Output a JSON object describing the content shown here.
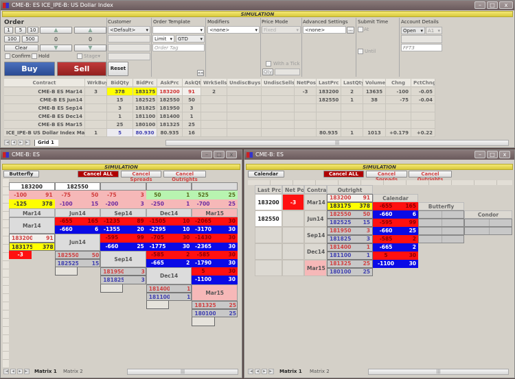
{
  "top_window": {
    "title": "CME-B: ES ICE_IPE-B: US Dollar Index",
    "sim_label": "SIMULATION"
  },
  "order": {
    "heading": "Order",
    "qty_buttons": [
      "1",
      "5",
      "10",
      "100",
      "500"
    ],
    "clear": "Clear",
    "spinner1_value": "0",
    "spinner2_value": "0",
    "confirm": "Confirm",
    "hold": "Hold",
    "stage": "Stage",
    "buy": "Buy",
    "sell": "Sell",
    "reset": "Reset",
    "customer_label": "Customer",
    "customer_value": "<Default>",
    "template_label": "Order Template",
    "template_value": "",
    "order_type": "Limit",
    "tif": "GTD",
    "order_tag_placeholder": "Order Tag",
    "collapse": "<<",
    "modifiers_label": "Modifiers",
    "modifiers_value": "<none>",
    "price_mode_label": "Price Mode",
    "price_mode_value": "Fixed",
    "with_tick": "With a Tick",
    "qty_label": "Qty",
    "advanced_label": "Advanced Settings",
    "advanced_value": "<none>",
    "advanced_btn": "...",
    "submit_label": "Submit Time",
    "at": "At",
    "until": "Until",
    "account_label": "Account Details",
    "account_state": "Open",
    "account_id": "A1",
    "account_name": "FFT3"
  },
  "grid": {
    "columns": [
      "Contract",
      "WrkBuys",
      "BidQty",
      "BidPrc",
      "AskPrc",
      "AskQty",
      "WrkSells",
      "UndiscBuys",
      "UndiscSells",
      "NetPos",
      "LastPrc",
      "LastQty",
      "Volume",
      "Chng",
      "PctChng"
    ],
    "rows": [
      [
        "CME-B ES Mar14",
        "3",
        "378",
        "183175",
        "183200",
        "91",
        "2",
        "",
        "",
        "-3",
        "183200",
        "2",
        "13635",
        "-100",
        "-0.05"
      ],
      [
        "CME-B ES Jun14",
        "",
        "15",
        "182525",
        "182550",
        "50",
        "",
        "",
        "",
        "",
        "182550",
        "1",
        "38",
        "-75",
        "-0.04"
      ],
      [
        "CME-B ES Sep14",
        "",
        "3",
        "181825",
        "181950",
        "3",
        "",
        "",
        "",
        "",
        "",
        "",
        "",
        "",
        ""
      ],
      [
        "CME-B ES Dec14",
        "",
        "1",
        "181100",
        "181400",
        "1",
        "",
        "",
        "",
        "",
        "",
        "",
        "",
        "",
        ""
      ],
      [
        "CME-B ES Mar15",
        "",
        "25",
        "180100",
        "181325",
        "25",
        "",
        "",
        "",
        "",
        "",
        "",
        "",
        "",
        ""
      ],
      [
        "ICE_IPE-B US Dollar Index Mar14",
        "1",
        "5",
        "80.930",
        "80.935",
        "16",
        "",
        "",
        "",
        "",
        "80.935",
        "1",
        "1013",
        "+0.179",
        "+0.22"
      ]
    ],
    "tabs": [
      "Grid 1"
    ]
  },
  "left_window": {
    "title": "CME-B: ES",
    "sim_label": "SIMULATION",
    "mode_button": "Butterfly",
    "cancel_all": "Cancel ALL",
    "cancel_spreads": "Cancel Spreads",
    "cancel_outrights": "Cancel Outrights",
    "row_marker": "L",
    "header_prices": [
      "183200",
      "182550",
      "",
      "",
      ""
    ],
    "top_rows": [
      [
        [
          "-100",
          "91"
        ],
        [
          "-75",
          "50"
        ],
        [
          "-75",
          "3"
        ],
        [
          "50",
          "1"
        ],
        [
          "525",
          "25"
        ]
      ],
      [
        [
          "-125",
          "378"
        ],
        [
          "-100",
          "15"
        ],
        [
          "-200",
          "3"
        ],
        [
          "-250",
          "1"
        ],
        [
          "-700",
          "25"
        ]
      ]
    ],
    "contracts": [
      "Mar14",
      "Jun14",
      "Sep14",
      "Dec14",
      "Mar15"
    ],
    "spreads": [
      [
        null,
        {
          "ask": [
            "-655",
            "165"
          ],
          "bid": [
            "-660",
            "6"
          ]
        },
        {
          "ask": [
            "-1235",
            "89"
          ],
          "bid": [
            "-1355",
            "20"
          ]
        },
        {
          "ask": [
            "-1505",
            "10"
          ],
          "bid": [
            "-2295",
            "10"
          ]
        },
        {
          "ask": [
            "-2065",
            "30"
          ],
          "bid": [
            "-3170",
            "30"
          ]
        }
      ],
      [
        null,
        null,
        {
          "ask": [
            "-595",
            "99"
          ],
          "bid": [
            "-660",
            "25"
          ]
        },
        {
          "ask": [
            "-705",
            "30"
          ],
          "bid": [
            "-1775",
            "30"
          ]
        },
        {
          "ask": [
            "-1430",
            "30"
          ],
          "bid": [
            "-2365",
            "30"
          ]
        }
      ],
      [
        null,
        null,
        null,
        {
          "ask": [
            "-585",
            "2"
          ],
          "bid": [
            "-665",
            "2"
          ]
        },
        {
          "ask": [
            "-585",
            "30"
          ],
          "bid": [
            "-1790",
            "30"
          ]
        }
      ],
      [
        null,
        null,
        null,
        null,
        {
          "ask": [
            "5",
            "30"
          ],
          "bid": [
            "-1100",
            "30"
          ]
        }
      ]
    ],
    "outrights": [
      {
        "ask": [
          "183200",
          "91"
        ],
        "bid": [
          "183175",
          "378"
        ],
        "netpos": "-3"
      },
      {
        "ask": [
          "182550",
          "50"
        ],
        "bid": [
          "182525",
          "15"
        ],
        "netpos": ""
      },
      {
        "ask": [
          "181950",
          "3"
        ],
        "bid": [
          "181825",
          "3"
        ],
        "netpos": ""
      },
      {
        "ask": [
          "181400",
          "1"
        ],
        "bid": [
          "181100",
          "1"
        ],
        "netpos": ""
      },
      {
        "ask": [
          "181325",
          "25"
        ],
        "bid": [
          "180100",
          "25"
        ],
        "netpos": ""
      }
    ],
    "tabs": [
      "Matrix 1",
      "Matrix 2"
    ]
  },
  "right_window": {
    "title": "CME-B: ES",
    "sim_label": "SIMULATION",
    "mode_button": "Calendar",
    "cancel_all": "Cancel ALL",
    "cancel_spreads": "Cancel Spreads",
    "cancel_outrights": "Cancel Outrights",
    "headers": [
      "Last Prc",
      "Net Pos",
      "Contract",
      "Outright"
    ],
    "calendar_header": "Calendar",
    "butterfly_header": "Butterfly",
    "condor_header": "Condor",
    "rows": [
      {
        "last": "183200",
        "netpos": "-3",
        "contract": "Mar14",
        "ask": [
          "183200",
          "91"
        ],
        "bid": [
          "183175",
          "378"
        ]
      },
      {
        "last": "182550",
        "netpos": "",
        "contract": "Jun14",
        "ask": [
          "182550",
          "50"
        ],
        "bid": [
          "182525",
          "15"
        ]
      },
      {
        "last": "",
        "netpos": "",
        "contract": "Sep14",
        "ask": [
          "181950",
          "3"
        ],
        "bid": [
          "181825",
          "3"
        ]
      },
      {
        "last": "",
        "netpos": "",
        "contract": "Dec14",
        "ask": [
          "181400",
          "1"
        ],
        "bid": [
          "181100",
          "1"
        ]
      },
      {
        "last": "",
        "netpos": "",
        "contract": "Mar15",
        "ask": [
          "181325",
          "25"
        ],
        "bid": [
          "180100",
          "25"
        ]
      }
    ],
    "calendar": [
      [
        "-655",
        "165"
      ],
      [
        "-660",
        "6"
      ],
      [
        "-595",
        "99"
      ],
      [
        "-660",
        "25"
      ],
      [
        "-585",
        "2"
      ],
      [
        "-665",
        "2"
      ],
      [
        "5",
        "30"
      ],
      [
        "-1100",
        "30"
      ]
    ],
    "tabs": [
      "Matrix 1",
      "Matrix 2"
    ]
  },
  "colors": {
    "buy": "#2f56a3",
    "sell": "#a92a2a",
    "ask_red": "#ff1010",
    "bid_blue": "#0a0ae6",
    "yellow": "#ffff00",
    "pink": "#f6b8b8",
    "green": "#b8f4b0",
    "cancel_all": "#b00000"
  }
}
